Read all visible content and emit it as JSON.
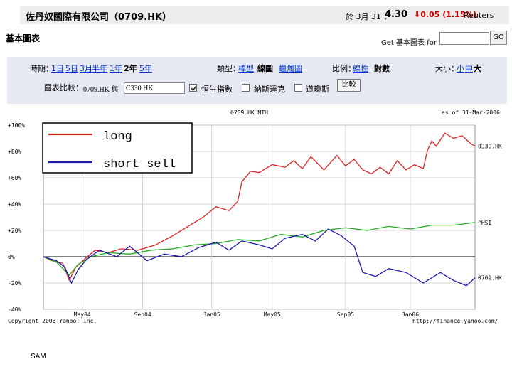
{
  "header": {
    "company_title": "佐丹奴國際有限公司（0709.HK）",
    "quote_date": "於 3月 31 ：",
    "price": "4.30",
    "change": "0.05 (1.15%)",
    "change_color": "#cc0000",
    "source": "Reuters"
  },
  "section": {
    "title": "基本圖表"
  },
  "lookup": {
    "label": "Get 基本圖表 for",
    "input_value": "",
    "button_label": "GO"
  },
  "options": {
    "period_label": "時期：",
    "periods": [
      "1日",
      "5日",
      "3月",
      "半年",
      "1年",
      "2年",
      "5年"
    ],
    "period_selected": "2年",
    "type_label": "類型：",
    "types": [
      "棒型",
      "線圖",
      "蠟燭圖"
    ],
    "type_selected": "線圖",
    "scale_label": "比例：",
    "scales": [
      "線性",
      "對數"
    ],
    "scale_selected": "對數",
    "size_label": "大小：",
    "sizes": [
      "小",
      "中",
      "大"
    ],
    "size_selected": "大",
    "compare_label": "圖表比較：",
    "compare_prefix": "0709.HK 與",
    "compare_value": "C330.HK",
    "indices": [
      {
        "label": "恒生指數",
        "checked": true
      },
      {
        "label": "納斯達克",
        "checked": false
      },
      {
        "label": "道瓊斯",
        "checked": false
      }
    ],
    "compare_button": "比較"
  },
  "chart_data": {
    "type": "line",
    "top_center_label": "0709.HK MTH",
    "top_right_label": "as of 31-Mar-2006",
    "y_ticks": [
      "+100%",
      "+80%",
      "+60%",
      "+40%",
      "+20%",
      "0%",
      "-20%",
      "-40%"
    ],
    "x_ticks": [
      "May04",
      "Sep04",
      "Jan05",
      "May05",
      "Sep05",
      "Jan06"
    ],
    "ylim": [
      -40,
      100
    ],
    "footer_left": "Copyright 2006 Yahoo! Inc.",
    "footer_right": "http://finance.yahoo.com/",
    "legend": [
      {
        "label": "long",
        "color": "#dd2222"
      },
      {
        "label": "short sell",
        "color": "#1a1aaa"
      }
    ],
    "series": [
      {
        "name": "0330.HK",
        "color": "#dd2222",
        "x": [
          0.0,
          0.02,
          0.045,
          0.06,
          0.075,
          0.095,
          0.12,
          0.15,
          0.18,
          0.22,
          0.26,
          0.3,
          0.34,
          0.37,
          0.4,
          0.43,
          0.45,
          0.46,
          0.48,
          0.5,
          0.53,
          0.56,
          0.58,
          0.6,
          0.62,
          0.65,
          0.68,
          0.7,
          0.72,
          0.74,
          0.76,
          0.78,
          0.8,
          0.82,
          0.84,
          0.86,
          0.88,
          0.89,
          0.9,
          0.91,
          0.93,
          0.95,
          0.97,
          0.99,
          1.0
        ],
        "values": [
          0,
          -3,
          -5,
          -18,
          -8,
          -2,
          5,
          3,
          6,
          5,
          9,
          16,
          24,
          30,
          38,
          35,
          42,
          57,
          65,
          64,
          70,
          68,
          73,
          67,
          76,
          66,
          77,
          69,
          74,
          66,
          63,
          68,
          63,
          73,
          66,
          70,
          67,
          81,
          88,
          84,
          94,
          90,
          92,
          86,
          84
        ]
      },
      {
        "name": "^HSI",
        "color": "#22aa22",
        "x": [
          0.0,
          0.03,
          0.06,
          0.08,
          0.11,
          0.15,
          0.2,
          0.25,
          0.3,
          0.35,
          0.4,
          0.45,
          0.5,
          0.55,
          0.6,
          0.65,
          0.7,
          0.75,
          0.8,
          0.85,
          0.9,
          0.95,
          1.0
        ],
        "values": [
          0,
          -4,
          -14,
          -6,
          0,
          3,
          2,
          5,
          6,
          9,
          10,
          13,
          12,
          17,
          15,
          20,
          22,
          20,
          23,
          21,
          24,
          24,
          26
        ]
      },
      {
        "name": "0709.HK",
        "color": "#1a1aaa",
        "x": [
          0.0,
          0.03,
          0.05,
          0.065,
          0.08,
          0.1,
          0.13,
          0.17,
          0.2,
          0.24,
          0.28,
          0.32,
          0.36,
          0.4,
          0.43,
          0.46,
          0.5,
          0.53,
          0.56,
          0.6,
          0.63,
          0.66,
          0.69,
          0.72,
          0.74,
          0.77,
          0.8,
          0.84,
          0.88,
          0.92,
          0.95,
          0.98,
          1.0
        ],
        "values": [
          0,
          -3,
          -8,
          -20,
          -10,
          -2,
          5,
          0,
          8,
          -3,
          2,
          0,
          7,
          11,
          5,
          12,
          9,
          6,
          14,
          17,
          12,
          21,
          16,
          8,
          -12,
          -15,
          -9,
          -12,
          -20,
          -12,
          -18,
          -22,
          -16
        ]
      }
    ]
  },
  "footer": {
    "label": "SAM"
  }
}
